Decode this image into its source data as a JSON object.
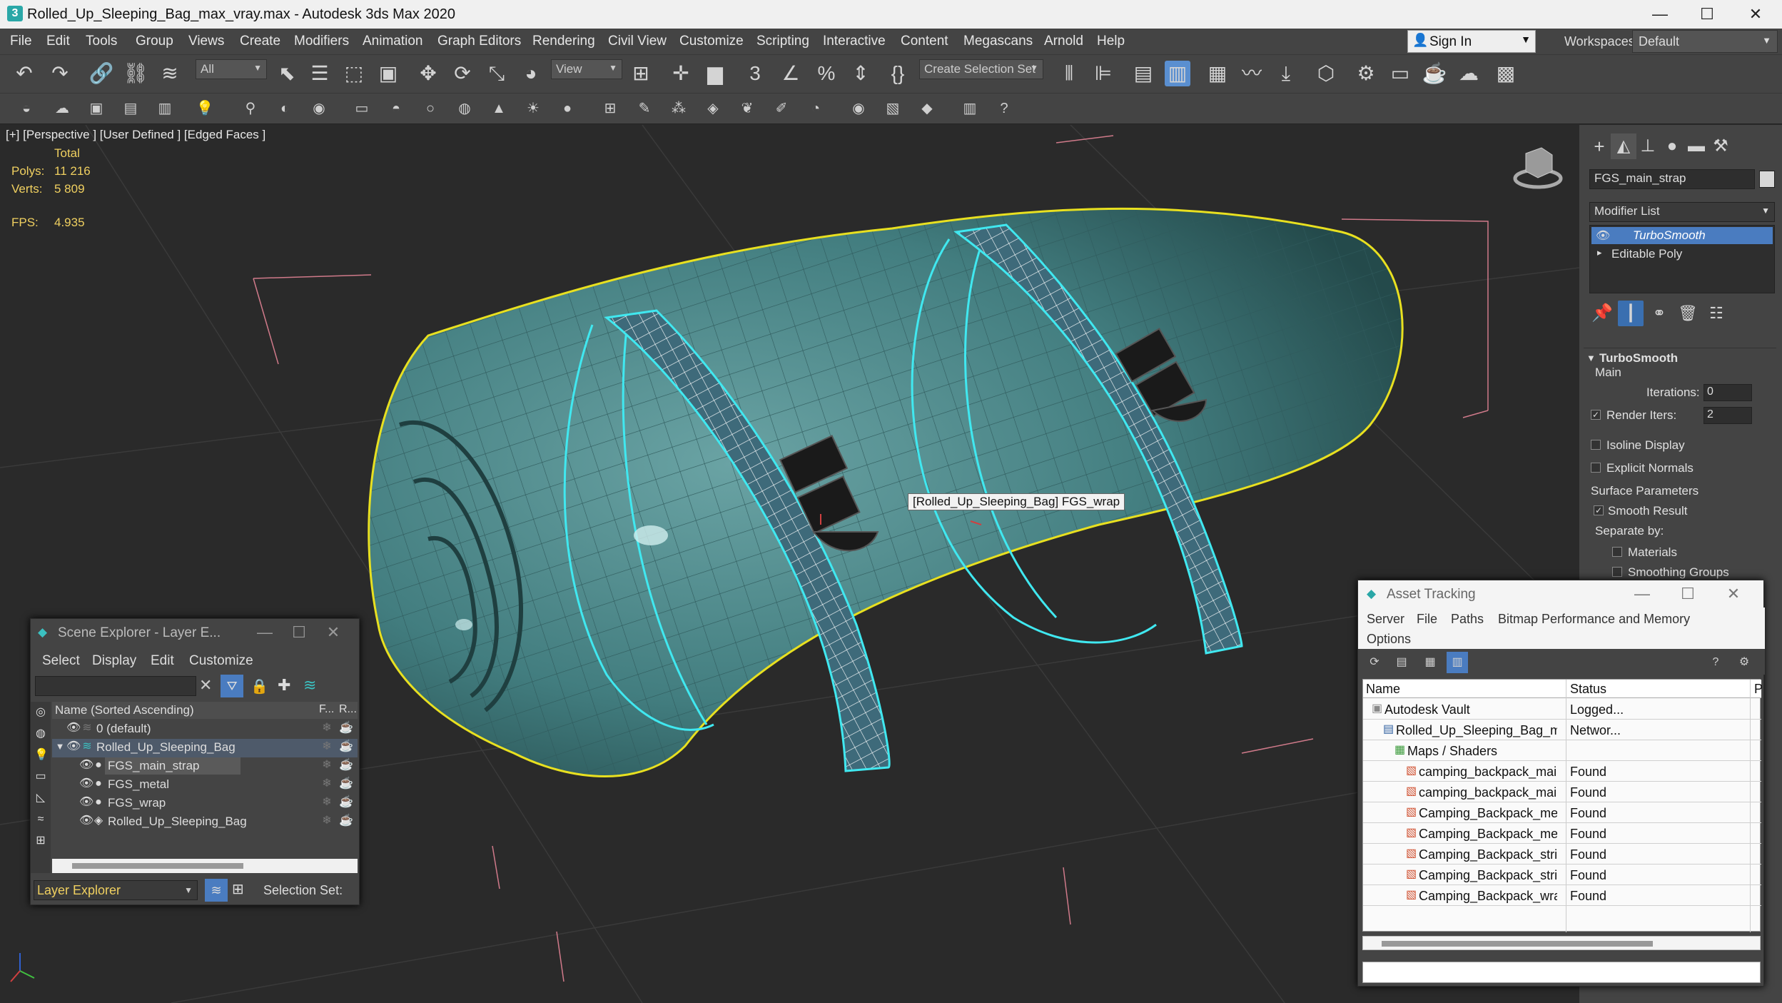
{
  "window": {
    "title": "Rolled_Up_Sleeping_Bag_max_vray.max - Autodesk 3ds Max 2020",
    "logo": "3",
    "minimize": "—",
    "maximize": "☐",
    "close": "✕"
  },
  "menu": [
    "File",
    "Edit",
    "Tools",
    "Group",
    "Views",
    "Create",
    "Modifiers",
    "Animation",
    "Graph Editors",
    "Rendering",
    "Civil View",
    "Customize",
    "Scripting",
    "Interactive",
    "Content",
    "Megascans",
    "Arnold",
    "Help"
  ],
  "signin": {
    "label": "Sign In"
  },
  "workspaces": {
    "label": "Workspaces:",
    "value": "Default"
  },
  "toolbar": {
    "filter_value": "All",
    "view_value": "View",
    "selection_set": "Create Selection Set"
  },
  "viewport": {
    "label": "[+] [Perspective ] [User Defined ] [Edged Faces ]",
    "stats_header": "Total",
    "polys_label": "Polys:",
    "polys_value": "11 216",
    "verts_label": "Verts:",
    "verts_value": "5 809",
    "fps_label": "FPS:",
    "fps_value": "4.935",
    "tooltip": "[Rolled_Up_Sleeping_Bag] FGS_wrap"
  },
  "command_panel": {
    "object_name": "FGS_main_strap",
    "modifier_list": "Modifier List",
    "stack": [
      "TurboSmooth",
      "Editable Poly"
    ],
    "rollout_title": "TurboSmooth",
    "main_label": "Main",
    "iterations_label": "Iterations:",
    "iterations_value": "0",
    "render_iters_label": "Render Iters:",
    "render_iters_value": "2",
    "isoline_label": "Isoline Display",
    "explicit_normals_label": "Explicit Normals",
    "surface_params_label": "Surface Parameters",
    "smooth_result_label": "Smooth Result",
    "separate_by_label": "Separate by:",
    "materials_label": "Materials",
    "smoothing_groups_label": "Smoothing Groups"
  },
  "scene_explorer": {
    "title": "Scene Explorer - Layer E...",
    "menu": [
      "Select",
      "Display",
      "Edit",
      "Customize"
    ],
    "column_name": "Name (Sorted Ascending)",
    "column_f": "F...",
    "column_r": "R...",
    "rows": [
      {
        "label": "0 (default)",
        "indent": 0
      },
      {
        "label": "Rolled_Up_Sleeping_Bag",
        "indent": 0
      },
      {
        "label": "FGS_main_strap",
        "indent": 1
      },
      {
        "label": "FGS_metal",
        "indent": 1
      },
      {
        "label": "FGS_wrap",
        "indent": 1
      },
      {
        "label": "Rolled_Up_Sleeping_Bag",
        "indent": 1
      }
    ],
    "footer_select": "Layer Explorer",
    "footer_selection_set": "Selection Set:"
  },
  "asset_tracking": {
    "title": "Asset Tracking",
    "menu": [
      "Server",
      "File",
      "Paths",
      "Bitmap Performance and Memory",
      "Options"
    ],
    "col_name": "Name",
    "col_status": "Status",
    "col_p": "P",
    "rows": [
      {
        "name": "Autodesk Vault",
        "status": "Logged...",
        "level": 0,
        "icon": "vault-icon"
      },
      {
        "name": "Rolled_Up_Sleeping_Bag_max_vray.max",
        "status": "Networ...",
        "level": 1,
        "icon": "max-file-icon"
      },
      {
        "name": "Maps / Shaders",
        "status": "",
        "level": 2,
        "icon": "maps-icon"
      },
      {
        "name": "camping_backpack_main_base_color.png",
        "status": "Found",
        "level": 3,
        "icon": "bitmap-icon"
      },
      {
        "name": "camping_backpack_main_bump.png",
        "status": "Found",
        "level": 3,
        "icon": "bitmap-icon"
      },
      {
        "name": "Camping_Backpack_metal_glossiness.png",
        "status": "Found",
        "level": 3,
        "icon": "bitmap-icon"
      },
      {
        "name": "Camping_Backpack_metal_specular.png",
        "status": "Found",
        "level": 3,
        "icon": "bitmap-icon"
      },
      {
        "name": "Camping_Backpack_stripe_normal.png",
        "status": "Found",
        "level": 3,
        "icon": "bitmap-icon"
      },
      {
        "name": "Camping_Backpack_stripe_specular.png",
        "status": "Found",
        "level": 3,
        "icon": "bitmap-icon"
      },
      {
        "name": "Camping_Backpack_wrap_normal.png",
        "status": "Found",
        "level": 3,
        "icon": "bitmap-icon"
      }
    ]
  },
  "colors": {
    "accent": "#2d6fb5",
    "selection_yellow": "#e8e020",
    "selection_cyan": "#40e8f0",
    "mesh_teal": "#3e7a7c"
  }
}
